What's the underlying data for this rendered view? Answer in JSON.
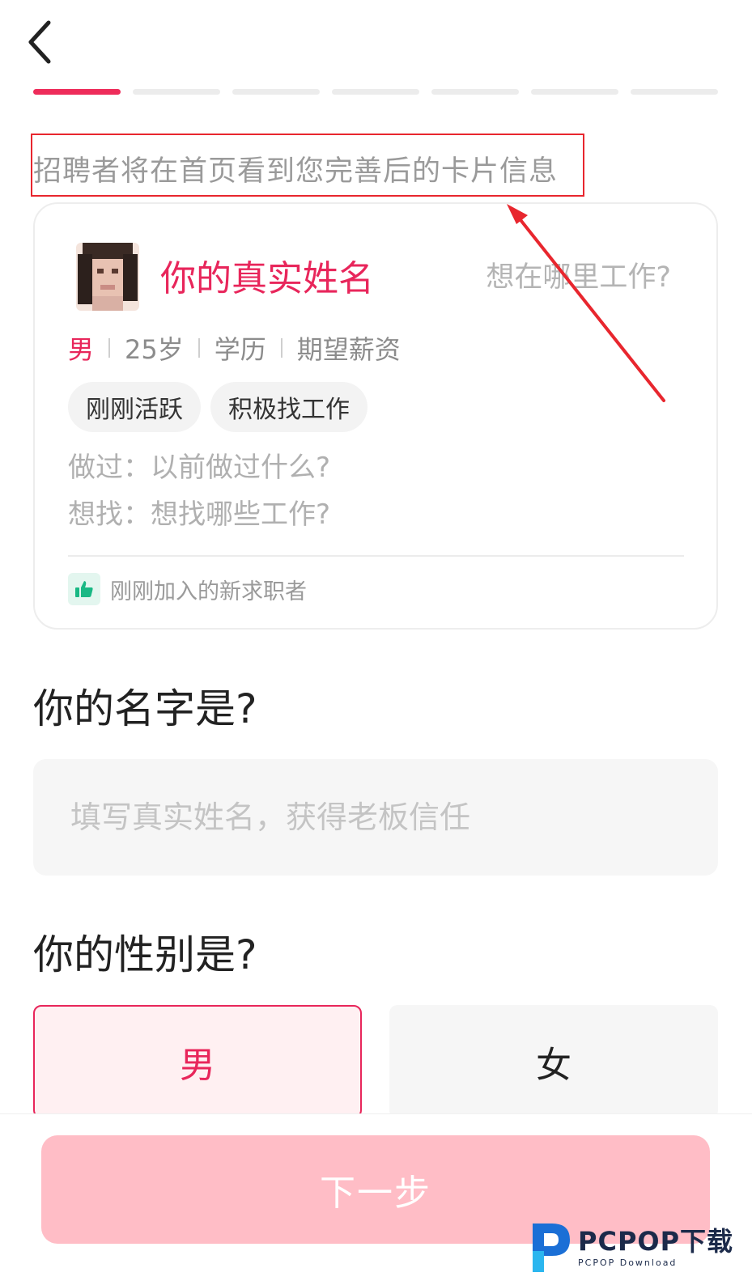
{
  "header": {
    "back_icon": "chevron-left-icon",
    "progress": {
      "total_steps": 7,
      "current_step": 1
    }
  },
  "hint": {
    "text": "招聘者将在首页看到您完善后的卡片信息"
  },
  "preview_card": {
    "name": "你的真实姓名",
    "where": "想在哪里工作?",
    "gender": "男",
    "age": "25岁",
    "education": "学历",
    "salary": "期望薪资",
    "tags": [
      "刚刚活跃",
      "积极找工作"
    ],
    "did": "做过：以前做过什么?",
    "want": "想找：想找哪些工作?",
    "joined": "刚刚加入的新求职者",
    "joined_icon": "thumbs-up-icon"
  },
  "name_section": {
    "question": "你的名字是?",
    "placeholder": "填写真实姓名，获得老板信任",
    "value": ""
  },
  "gender_section": {
    "question": "你的性别是?",
    "options": [
      "男",
      "女"
    ],
    "selected": "男"
  },
  "footer": {
    "next_label": "下一步"
  },
  "watermark": {
    "main": "PCPOP下载",
    "sub": "PCPOP Download"
  },
  "colors": {
    "accent": "#e8265b",
    "progress_active": "#ee2c5a",
    "next_button": "#ffbdc6",
    "annotation": "#e8262e"
  }
}
